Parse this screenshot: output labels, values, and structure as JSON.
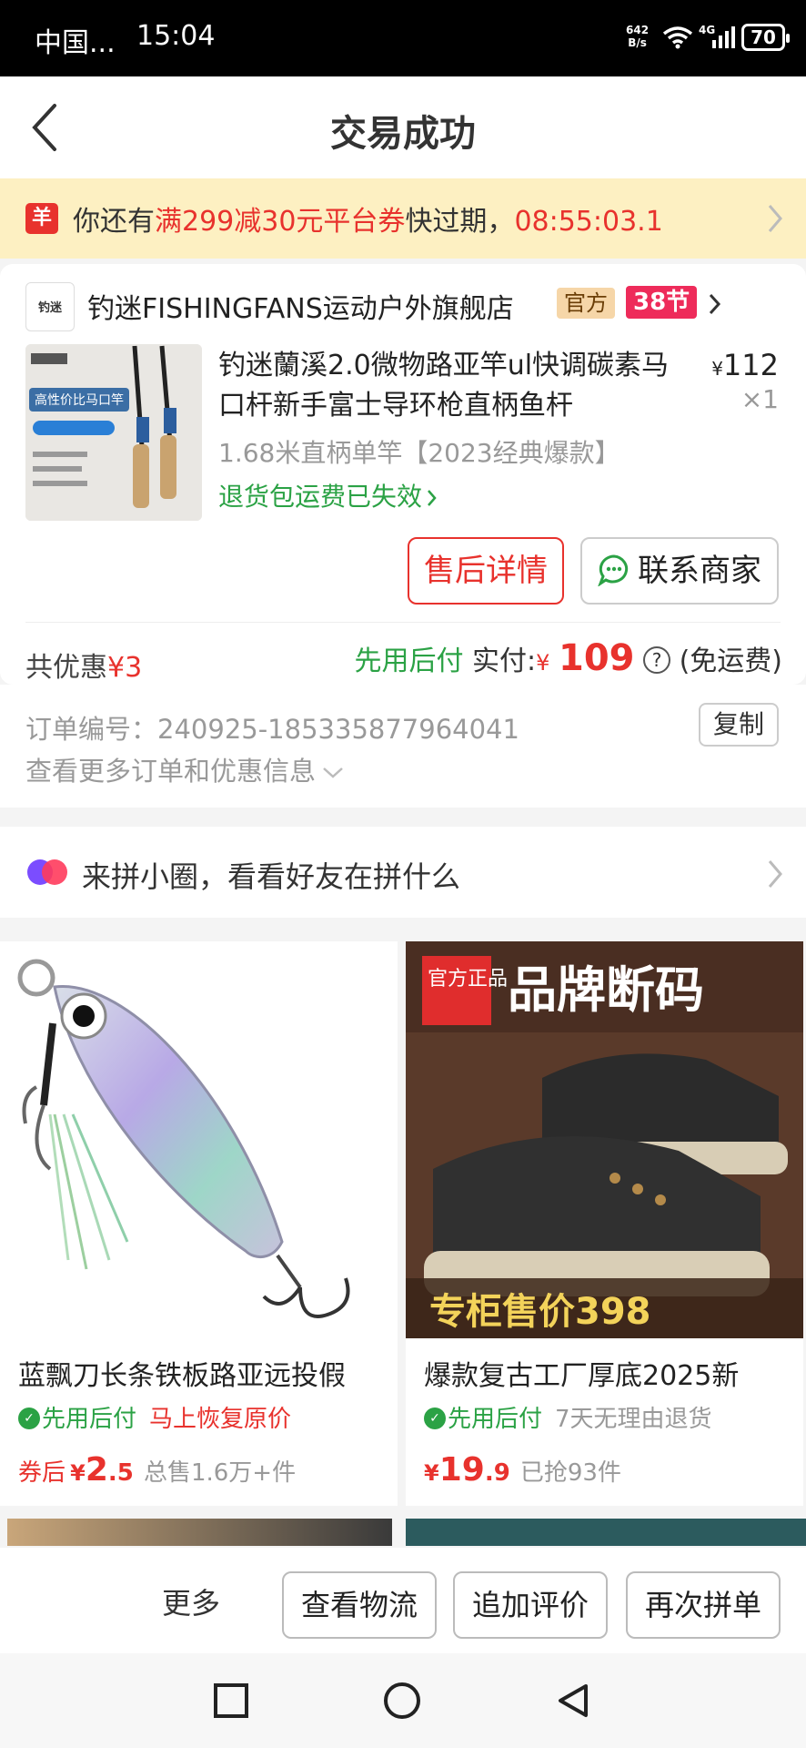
{
  "status_bar": {
    "carrier": "中国...",
    "time": "15:04",
    "speed_value": "642",
    "speed_unit": "B/s",
    "network": "4G",
    "battery": "70"
  },
  "header": {
    "title": "交易成功"
  },
  "coupon": {
    "badge": "羊",
    "prefix": "你还有",
    "highlight": "满299减30元平台券",
    "suffix": "快过期，",
    "countdown": "08:55:03.1"
  },
  "store": {
    "logo_text": "钓迷",
    "name": "钓迷FISHINGFANS运动户外旗舰店",
    "tag_official": "官方",
    "tag_festival": "38节"
  },
  "product": {
    "image_caption": "高性价比马口竿",
    "title": "钓迷蘭溪2.0微物路亚竿ul快调碳素马口杆新手富士导环枪直柄鱼杆",
    "currency": "¥",
    "price": "112",
    "quantity": "×1",
    "spec": "1.68米直柄单竿【2023经典爆款】",
    "return_notice": "退货包运费已失效"
  },
  "order_buttons": {
    "after_sales": "售后详情",
    "contact": "联系商家"
  },
  "summary": {
    "saving_label": "共优惠",
    "saving_amount": "¥3",
    "pay_later": "先用后付",
    "paid_label": "实付:",
    "currency": "¥",
    "paid_amount": "109",
    "help_icon": "?",
    "shipping": "(免运费)"
  },
  "order_info": {
    "number_label": "订单编号：",
    "number": "240925-185335877964041",
    "copy": "复制",
    "more": "查看更多订单和优惠信息"
  },
  "group": {
    "text": "来拼小圈，看看好友在拼什么"
  },
  "feed": [
    {
      "title": "蓝飘刀长条铁板路亚远投假",
      "pay_tag": "先用后付",
      "promo": "马上恢复原价",
      "price_prefix": "券后",
      "currency": "¥",
      "price_int": "2",
      "price_dec": ".5",
      "sold": "总售1.6万+件"
    },
    {
      "banner_tag": "官方正品",
      "banner_title": "品牌断码",
      "banner_price": "专柜售价398",
      "title": "爆款复古工厂厚底2025新",
      "pay_tag": "先用后付",
      "promo": "7天无理由退货",
      "price_prefix": "",
      "currency": "¥",
      "price_int": "19",
      "price_dec": ".9",
      "sold": "已抢93件"
    }
  ],
  "actions": {
    "more": "更多",
    "logistics": "查看物流",
    "review": "追加评价",
    "reorder": "再次拼单"
  },
  "colors": {
    "accent_red": "#e8322d",
    "pay_green": "#2ba245",
    "coupon_bg": "#fdf0c2"
  }
}
